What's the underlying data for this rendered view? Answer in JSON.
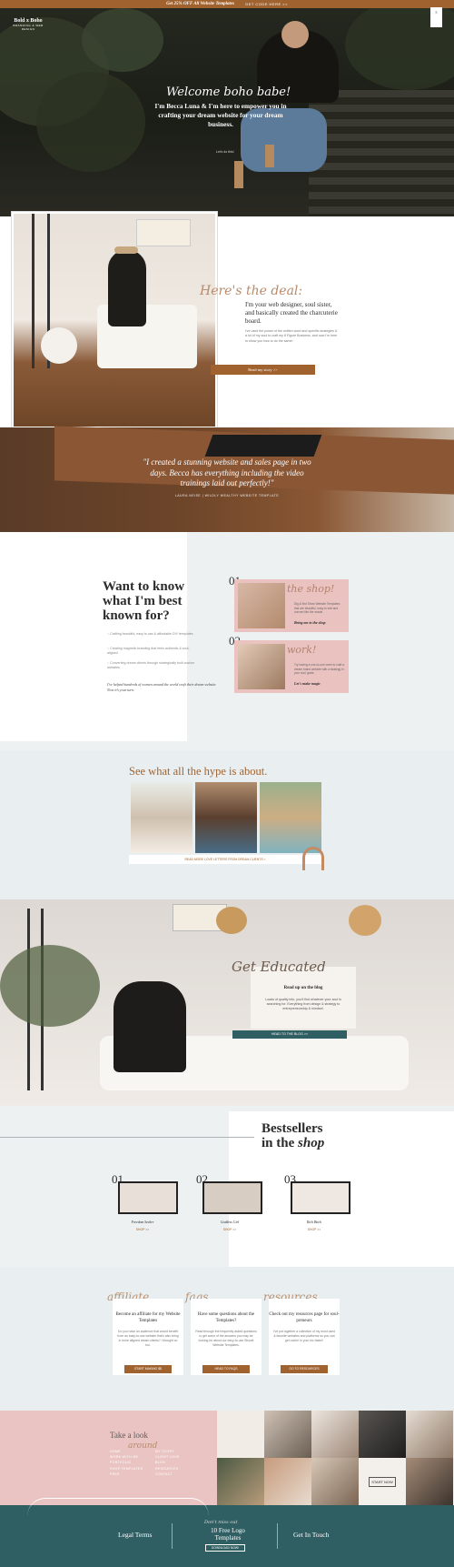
{
  "topbar": {
    "promo": "Get 25% OFF All Website Templates",
    "cta": "GET CODE HERE >>"
  },
  "header": {
    "logo_line1": "Bold x Boho",
    "logo_line2": "BRANDING & WEB DESIGN",
    "menu": "≡"
  },
  "hero": {
    "script": "Welcome boho babe!",
    "text": "I'm Becca Luna & I'm here to empower you in crafting your dream website for your dream business.",
    "link": "Let's do this!"
  },
  "about": {
    "script": "Here's the deal:",
    "headline": "I'm your web designer, soul sister, and basically created the charcuterie board.",
    "body": "I've used the power of the written word and specific strategies & a lot of my soul to craft my 8 Figure Business, and now I'm here to show you how to do the same!",
    "button": "Read my story >>"
  },
  "testimonial": {
    "quote": "\"I created a stunning website and sales page in two days. Becca has everything including the video trainings laid out perfectly!\"",
    "author": "LAURA NEISE | WILDLY WEALTHY WEBSITE TEMPLATE"
  },
  "services": {
    "headline": "Want to know what I'm best known for?",
    "items": [
      "Crafting beautiful, easy to use & affordable DIY templates",
      "Creating magnetic branding that feels authentic & soul-aligned",
      "Converting dream clients through strategically built custom websites"
    ],
    "footer": "I've helped hundreds of women around the world craft their dream website. Now it's your turn.",
    "cards": [
      {
        "num": "01",
        "script": "the shop!",
        "text": "Dig & find Show Website Templates that are beautiful, easy to edit and convert like the wowie.",
        "link": "Bring me to the shop"
      },
      {
        "num": "02",
        "script": "work!",
        "text": "Try having a one-to-one meet to craft a dream brand website with a strategy in your soul goals.",
        "link": "Let's make magic"
      }
    ]
  },
  "hype": {
    "headline": "See what all the hype is about.",
    "bar": "READ MORE LOVE LETTERS FROM DREAM CLIENTS >"
  },
  "blog": {
    "script": "Get Educated",
    "headline": "Read up on the blog",
    "body": "Loads of quality info, you'll find whatever your soul is searching for. Everything from design & strategy to entrepreneurship & mindset.",
    "button": "HEAD TO THE BLOG >>"
  },
  "bestsellers": {
    "headline_line1": "Bestsellers",
    "headline_line2": "in the",
    "headline_italic": "shop",
    "products": [
      {
        "num": "01",
        "name": "Freedom Seeker",
        "shop": "SHOP >>"
      },
      {
        "num": "02",
        "name": "Goddess Girl",
        "shop": "SHOP >>"
      },
      {
        "num": "03",
        "name": "Rich Bitch",
        "shop": "SHOP >>"
      }
    ]
  },
  "info": {
    "cards": [
      {
        "script": "affiliate",
        "head": "Become an affiliate for my Website Templates",
        "body": "Do you have an audience that would benefit from an easy-to-use website that's also bring in more aligned dream clients? I thought so too.",
        "button": "START MAKING $$"
      },
      {
        "script": "faqs",
        "head": "Have some questions about the Templates?",
        "body": "Read through the frequently asked questions to get some of the answers you may be looking for about our easy-to-use Showit Website Templates.",
        "button": "HEAD TO FAQS"
      },
      {
        "script": "resources",
        "head": "Check out my resources page for soul-preneurs",
        "body": "I've put together a collection of my most used & favorite websites and platforms so you can get rockin' in your biz faster!",
        "button": "GO TO RESOURCES"
      }
    ]
  },
  "footer": {
    "take": "Take a look",
    "around": "around",
    "links_left": [
      "HOME",
      "WORK WITH ME",
      "PORTFOLIO",
      "SHOP TEMPLATES",
      "FREE"
    ],
    "links_right": [
      "MY STORY",
      "CLIENT LOVE",
      "BLOG",
      "RESOURCES",
      "CONTACT"
    ],
    "gallery_note": "START NOW",
    "legal": "Legal Terms",
    "free_script": "Don't miss out",
    "free_head": "10 Free Logo Templates",
    "free_button": "DOWNLOAD NOW!",
    "contact": "Get In Touch"
  },
  "colors": {
    "accent": "#a0622f",
    "teal": "#2f5e63",
    "pink": "#e9c4c2",
    "bg": "#edf1f2"
  }
}
